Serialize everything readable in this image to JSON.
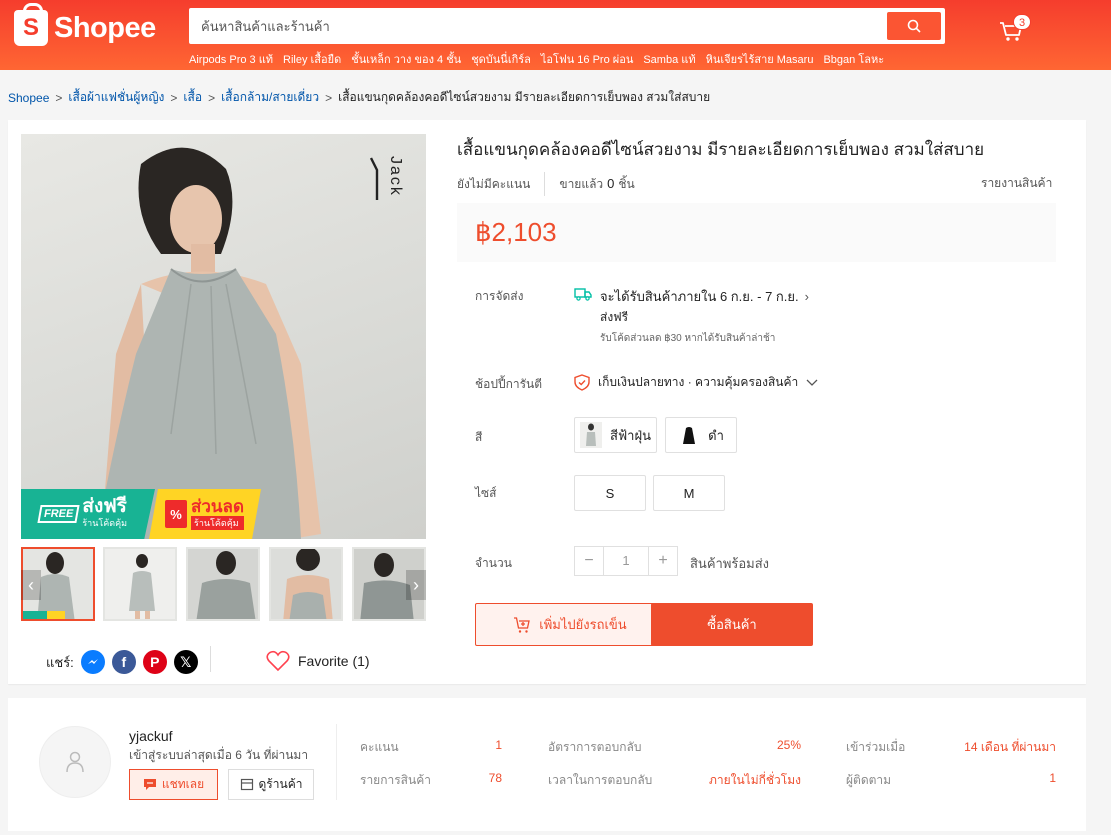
{
  "header": {
    "logo_text": "Shopee",
    "search_placeholder": "ค้นหาสินค้าและร้านค้า",
    "suggestions": [
      "Airpods Pro 3 แท้",
      "Riley เสื้อยืด",
      "ชั้นเหล็ก วาง ของ 4 ชั้น",
      "ชุดบันนี่เกิร์ล",
      "ไอโฟน 16 Pro ผ่อน",
      "Samba แท้",
      "หินเจียรไร้สาย Masaru",
      "Bbgan โลหะ"
    ],
    "cart_count": "3"
  },
  "breadcrumb": {
    "items": [
      "Shopee",
      "เสื้อผ้าแฟชั่นผู้หญิง",
      "เสื้อ",
      "เสื้อกล้าม/สายเดี่ยว"
    ],
    "current": "เสื้อแขนกุดคล้องคอดีไซน์สวยงาม มีรายละเอียดการเย็บพอง สวมใส่สบาย",
    "separator": ">"
  },
  "product": {
    "brand_watermark": "Jack",
    "promo": {
      "free_tag": "FREE",
      "free_main": "ส่งฟรี",
      "free_sub": "ร้านโค้ดคุ้ม",
      "disc_icon": "%",
      "disc_main": "ส่วนลด",
      "disc_sub": "ร้านโค้ดคุ้ม"
    },
    "title": "เสื้อแขนกุดคล้องคอดีไซน์สวยงาม มีรายละเอียดการเย็บพอง สวมใส่สบาย",
    "rating_text": "ยังไม่มีคะแนน",
    "sold_label": "ขายแล้ว",
    "sold_count": "0",
    "sold_unit": "ชิ้น",
    "report": "รายงานสินค้า",
    "price": "฿2,103",
    "shipping": {
      "label": "การจัดส่ง",
      "line1": "จะได้รับสินค้าภายใน 6 ก.ย. - 7 ก.ย.",
      "line2": "ส่งฟรี",
      "line3": "รับโค้ดส่วนลด ฿30 หากได้รับสินค้าล่าช้า"
    },
    "guarantee": {
      "label": "ช้อปปี้การันตี",
      "text": "เก็บเงินปลายทาง · ความคุ้มครองสินค้า"
    },
    "color": {
      "label": "สี",
      "options": [
        "สีฟ้าฝุ่น",
        "ดำ"
      ]
    },
    "size": {
      "label": "ไซส์",
      "options": [
        "S",
        "M"
      ]
    },
    "quantity": {
      "label": "จำนวน",
      "minus": "−",
      "value": "1",
      "plus": "+",
      "stock": "สินค้าพร้อมส่ง"
    },
    "add_to_cart": "เพิ่มไปยังรถเข็น",
    "buy_now": "ซื้อสินค้า",
    "share_label": "แชร์:",
    "favorite": "Favorite (1)"
  },
  "shop": {
    "name": "yjackuf",
    "active": "เข้าสู่ระบบล่าสุดเมื่อ 6 วัน ที่ผ่านมา",
    "chat": "แชทเลย",
    "view": "ดูร้านค้า",
    "stats": [
      {
        "label": "คะแนน",
        "value": "1"
      },
      {
        "label": "รายการสินค้า",
        "value": "78"
      },
      {
        "label": "อัตราการตอบกลับ",
        "value": "25%"
      },
      {
        "label": "เวลาในการตอบกลับ",
        "value": "ภายในไม่กี่ชั่วโมง"
      },
      {
        "label": "เข้าร่วมเมื่อ",
        "value": "14 เดือน ที่ผ่านมา"
      },
      {
        "label": "ผู้ติดตาม",
        "value": "1"
      }
    ]
  },
  "colors": {
    "brand": "#ee4d2d",
    "header": "#f53d2d",
    "link": "#0055aa"
  }
}
